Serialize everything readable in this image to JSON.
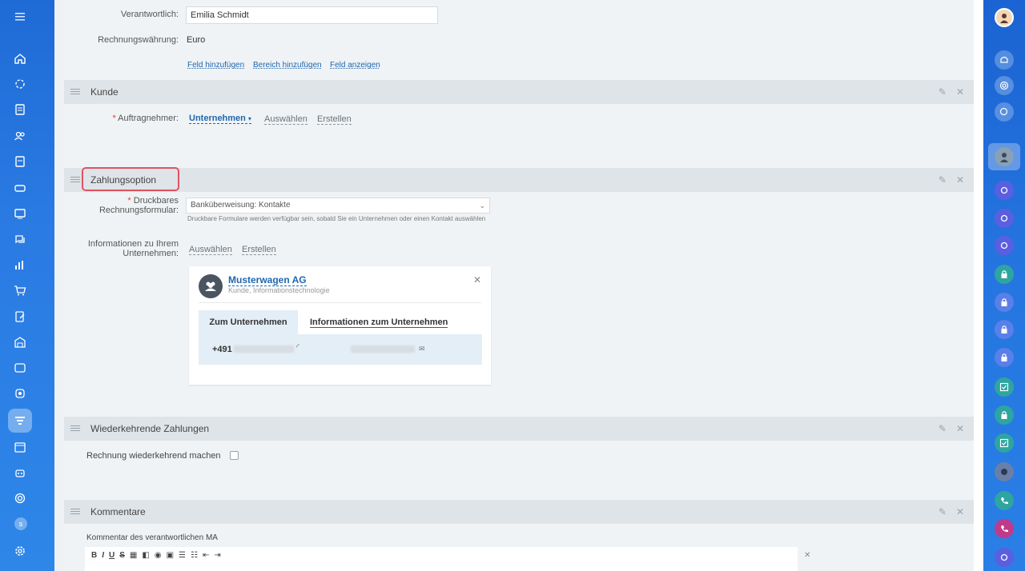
{
  "fields": {
    "responsible_label": "Verantwortlich:",
    "responsible_value": "Emilia Schmidt",
    "currency_label": "Rechnungswährung:",
    "currency_value": "Euro",
    "add_field": "Feld hinzufügen",
    "add_section": "Bereich hinzufügen",
    "show_field": "Feld anzeigen"
  },
  "kunde": {
    "title": "Kunde",
    "contractor_label": "Auftragnehmer:",
    "required_mark": "*",
    "company_type": "Unternehmen",
    "select": "Auswählen",
    "create": "Erstellen"
  },
  "zahlung": {
    "title": "Zahlungsoption",
    "form_label_1": "Druckbares",
    "form_label_2": "Rechnungsformular:",
    "form_value": "Banküberweisung: Kontakte",
    "form_hint": "Druckbare Formulare werden verfügbar sein, sobald Sie ein Unternehmen oder einen Kontakt auswählen",
    "info_label_1": "Informationen zu Ihrem",
    "info_label_2": "Unternehmen:",
    "select": "Auswählen",
    "create": "Erstellen",
    "company_card": {
      "name": "Musterwagen AG",
      "subtitle": "Kunde, Informationstechnologie",
      "tab_company": "Zum Unternehmen",
      "tab_info": "Informationen zum Unternehmen",
      "phone_prefix": "+491"
    }
  },
  "recurring": {
    "title": "Wiederkehrende Zahlungen",
    "checkbox_label": "Rechnung wiederkehrend machen"
  },
  "comments": {
    "title": "Kommentare",
    "label": "Kommentar des verantwortlichen MA",
    "toolbar": [
      "B",
      "I",
      "U",
      "S"
    ]
  },
  "sidebar": {
    "s_badge": "s"
  },
  "colors": {
    "accent": "#2067b0",
    "sidebar": "#2a7be3",
    "highlight": "#e05360"
  }
}
